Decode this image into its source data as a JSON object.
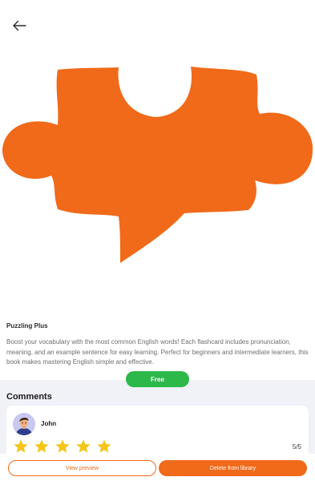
{
  "header": {
    "back_icon": "arrow-left-icon"
  },
  "hero": {
    "icon": "puzzle-speech-bubble-icon",
    "color": "#F06A1A"
  },
  "book": {
    "title": "Puzzling Plus",
    "description": "Boost your vocabulary with the most common English words! Each flashcard includes pronunciation, meaning, and an example sentence for easy learning. Perfect for beginners and intermediate learners, this book makes mastering English simple and effective.",
    "price_label": "Free"
  },
  "comments": {
    "heading": "Comments",
    "items": [
      {
        "name": "John",
        "avatar": "user-avatar",
        "stars": 5,
        "rating_label": "5/5"
      }
    ]
  },
  "actions": {
    "preview_label": "View preview",
    "delete_label": "Delete from library"
  },
  "colors": {
    "accent": "#F06A1A",
    "price_pill": "#2DB84A",
    "star": "#F5C518",
    "panel_bg": "#F1F1F8"
  }
}
